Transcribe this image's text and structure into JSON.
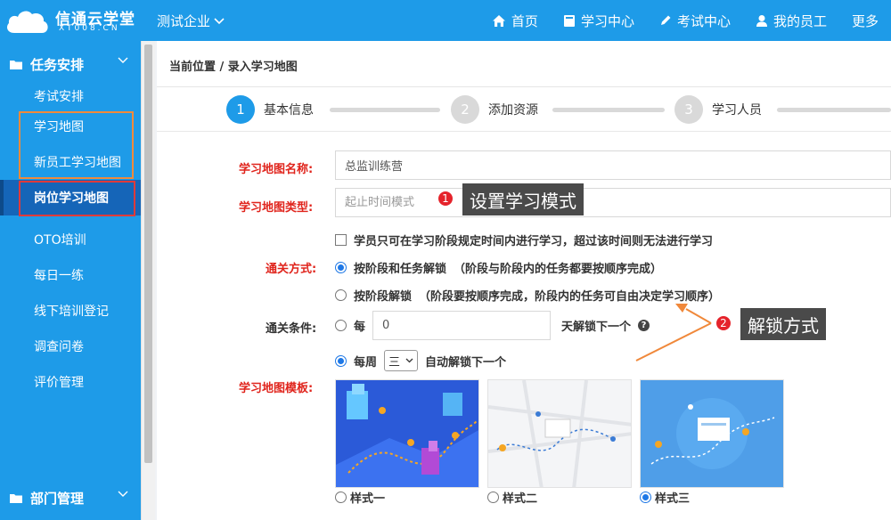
{
  "app": {
    "logo_title": "信通云学堂",
    "logo_sub": "XT008.CN",
    "company": "测试企业",
    "nav": [
      {
        "label": "首页",
        "icon": "home-icon"
      },
      {
        "label": "学习中心",
        "icon": "book-icon"
      },
      {
        "label": "考试中心",
        "icon": "pencil-icon"
      },
      {
        "label": "我的员工",
        "icon": "user-icon"
      },
      {
        "label": "更多",
        "icon": ""
      }
    ],
    "brand_color": "#1e9be8"
  },
  "sidebar": {
    "group1": {
      "label": "任务安排",
      "icon": "folder-icon"
    },
    "items": [
      {
        "label": "考试安排"
      },
      {
        "label": "学习地图"
      },
      {
        "label": "新员工学习地图"
      },
      {
        "label": "岗位学习地图",
        "active": true
      },
      {
        "label": "OTO培训"
      },
      {
        "label": "每日一练"
      },
      {
        "label": "线下培训登记"
      },
      {
        "label": "调查问卷"
      },
      {
        "label": "评价管理"
      }
    ],
    "group2": {
      "label": "部门管理",
      "icon": "folder-icon"
    }
  },
  "breadcrumb": "当前位置 / 录入学习地图",
  "steps": [
    {
      "num": "1",
      "label": "基本信息",
      "active": true
    },
    {
      "num": "2",
      "label": "添加资源",
      "active": false
    },
    {
      "num": "3",
      "label": "学习人员",
      "active": false
    }
  ],
  "form": {
    "name_label": "学习地图名称:",
    "name_value": "总监训练营",
    "type_label": "学习地图类型:",
    "type_placeholder": "起止时间模式",
    "limit_checkbox": "学员只可在学习阶段规定时间内进行学习，超过该时间则无法进行学习",
    "pass_label": "通关方式:",
    "pass_options": [
      {
        "main": "按阶段和任务解锁",
        "desc": "（阶段与阶段内的任务都要按顺序完成）",
        "selected": true
      },
      {
        "main": "按阶段解锁",
        "desc": "（阶段要按顺序完成，阶段内的任务可自由决定学习顺序）",
        "selected": false
      }
    ],
    "cond_label": "通关条件:",
    "cond_every": "每",
    "cond_days": "0",
    "cond_unlock": "天解锁下一个",
    "help_icon": "question-icon",
    "week_prefix": "每周",
    "week_value": "三",
    "week_suffix": "自动解锁下一个",
    "cond_selected": "weekly",
    "template_label": "学习地图模板:",
    "templates": [
      {
        "label": "样式一",
        "selected": false
      },
      {
        "label": "样式二",
        "selected": false
      },
      {
        "label": "样式三",
        "selected": true
      }
    ]
  },
  "annotations": [
    {
      "num": "1",
      "text": "设置学习模式"
    },
    {
      "num": "2",
      "text": "解锁方式"
    }
  ]
}
